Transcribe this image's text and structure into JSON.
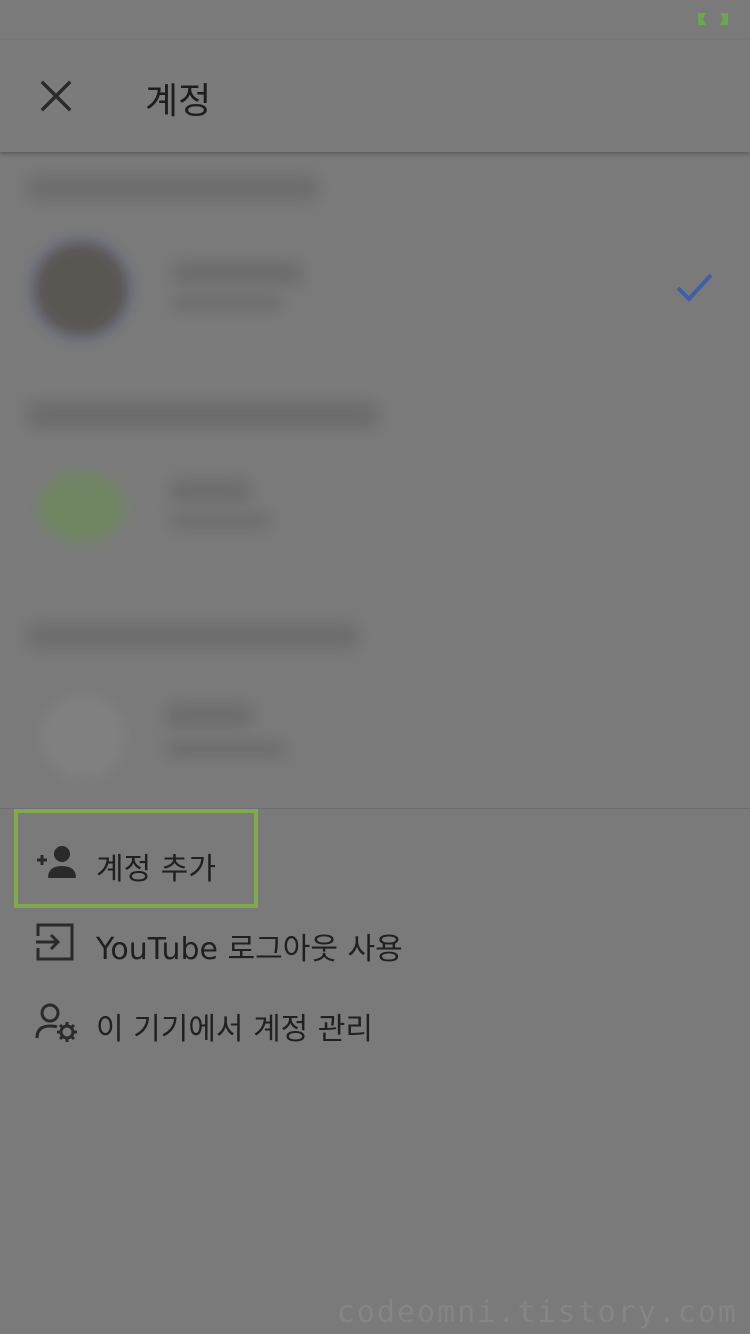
{
  "appbar": {
    "title": "계정"
  },
  "icons": {
    "close": "close-icon",
    "check": "checkmark-icon",
    "add_account": "person-add-icon",
    "sign_out": "logout-icon",
    "manage": "manage-accounts-icon",
    "battery": "battery-icon"
  },
  "colors": {
    "check": "#3f5fa8",
    "highlight": "#7faa4e",
    "battery": "#6aa84f"
  },
  "menu": {
    "add_account": "계정 추가",
    "sign_out": "YouTube 로그아웃 사용",
    "manage": "이 기기에서 계정 관리"
  },
  "watermark": "codeomni.tistory.com"
}
